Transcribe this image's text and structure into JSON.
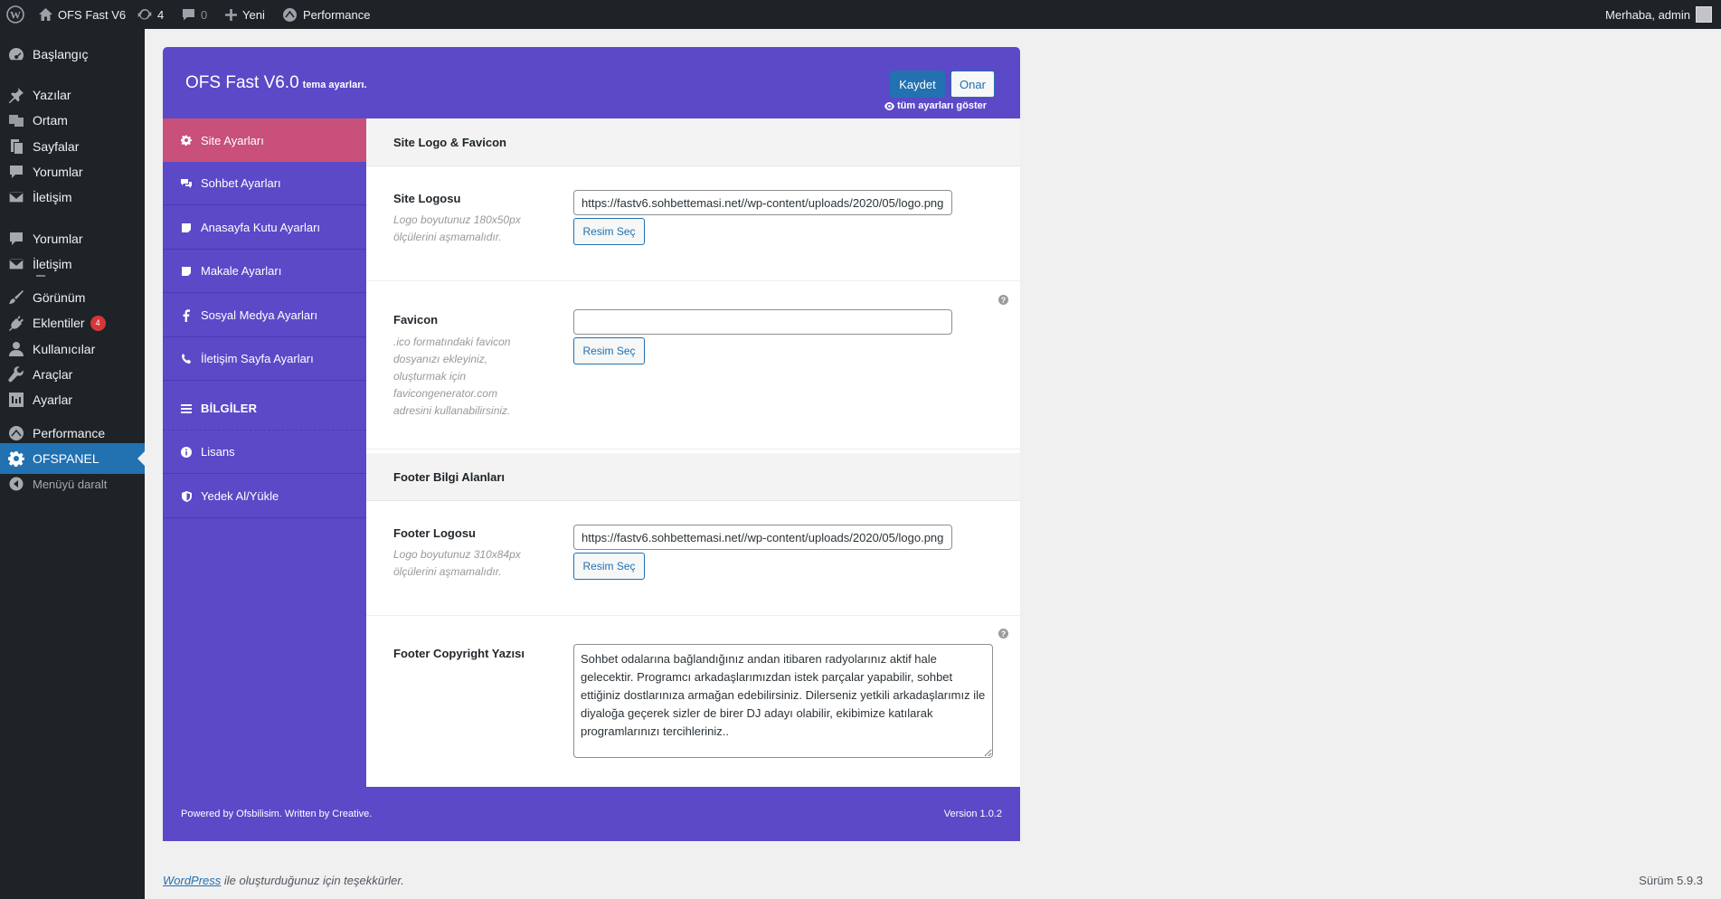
{
  "admin_bar": {
    "site_name": "OFS Fast V6",
    "updates_count": "4",
    "comments_count": "0",
    "new_label": "Yeni",
    "performance_label": "Performance",
    "greeting": "Merhaba, admin"
  },
  "admin_menu": {
    "items": [
      {
        "label": "Başlangıç",
        "icon": "dashboard-icon"
      },
      {
        "label": "Yazılar",
        "icon": "pin-icon"
      },
      {
        "label": "Ortam",
        "icon": "media-icon"
      },
      {
        "label": "Sayfalar",
        "icon": "pages-icon"
      },
      {
        "label": "Yorumlar",
        "icon": "comments-icon"
      },
      {
        "label": "İletişim",
        "icon": "mail-icon"
      },
      {
        "label": "Yorumlar",
        "icon": "comments-icon"
      },
      {
        "label": "İletişim",
        "icon": "mail-icon"
      },
      {
        "label": "Görünüm",
        "icon": "brush-icon"
      },
      {
        "label": "Eklentiler",
        "icon": "plugin-icon",
        "badge": "4"
      },
      {
        "label": "Kullanıcılar",
        "icon": "user-icon"
      },
      {
        "label": "Araçlar",
        "icon": "wrench-icon"
      },
      {
        "label": "Ayarlar",
        "icon": "settings-icon"
      },
      {
        "label": "Performance",
        "icon": "performance-icon"
      },
      {
        "label": "OFSPANEL",
        "icon": "gear-icon",
        "current": true
      },
      {
        "label": "Menüyü daralt",
        "icon": "collapse-icon"
      }
    ]
  },
  "panel": {
    "title": "OFS Fast V6.0",
    "subtitle": "tema ayarları.",
    "save_label": "Kaydet",
    "reset_label": "Onar",
    "show_all_label": "tüm ayarları göster",
    "nav": [
      {
        "label": "Site Ayarları",
        "icon": "gear-icon",
        "active": true
      },
      {
        "label": "Sohbet Ayarları",
        "icon": "chat-icon"
      },
      {
        "label": "Anasayfa Kutu Ayarları",
        "icon": "box-icon"
      },
      {
        "label": "Makale Ayarları",
        "icon": "article-icon"
      },
      {
        "label": "Sosyal Medya Ayarları",
        "icon": "facebook-icon"
      },
      {
        "label": "İletişim Sayfa Ayarları",
        "icon": "phone-icon"
      },
      {
        "label": "BİLGİLER",
        "icon": "list-icon",
        "heading": true
      },
      {
        "label": "Lisans",
        "icon": "info-icon"
      },
      {
        "label": "Yedek Al/Yükle",
        "icon": "shield-icon"
      }
    ],
    "sections": {
      "logo_favicon": "Site Logo & Favicon",
      "footer_info": "Footer Bilgi Alanları"
    },
    "fields": {
      "site_logo": {
        "label": "Site Logosu",
        "desc": "Logo boyutunuz 180x50px ölçülerini aşmamalıdır.",
        "value": "https://fastv6.sohbettemasi.net//wp-content/uploads/2020/05/logo.png",
        "button": "Resim Seç"
      },
      "favicon": {
        "label": "Favicon",
        "desc": ".ico formatındaki favicon dosyanızı ekleyiniz, oluşturmak için favicongenerator.com adresini kullanabilirsiniz.",
        "value": "",
        "button": "Resim Seç"
      },
      "footer_logo": {
        "label": "Footer Logosu",
        "desc": "Logo boyutunuz 310x84px ölçülerini aşmamalıdır.",
        "value": "https://fastv6.sohbettemasi.net//wp-content/uploads/2020/05/logo.png",
        "button": "Resim Seç"
      },
      "footer_copyright": {
        "label": "Footer Copyright Yazısı",
        "value": "Sohbet odalarına bağlandığınız andan itibaren radyolarınız aktif hale gelecektir. Programcı arkadaşlarımızdan istek parçalar yapabilir, sohbet ettiğiniz dostlarınıza armağan edebilirsiniz. Dilerseniz yetkili arkadaşlarımız ile diyaloğa geçerek sizler de birer DJ adayı olabilir, ekibimize katılarak programlarınızı tercihleriniz.."
      }
    },
    "footer": {
      "powered": "Powered by Ofsbilisim. Written by Creative.",
      "version": "Version 1.0.2"
    }
  },
  "wp_footer": {
    "link_text": "WordPress",
    "thanks": " ile oluşturduğunuz için teşekkürler.",
    "version": "Sürüm 5.9.3"
  }
}
